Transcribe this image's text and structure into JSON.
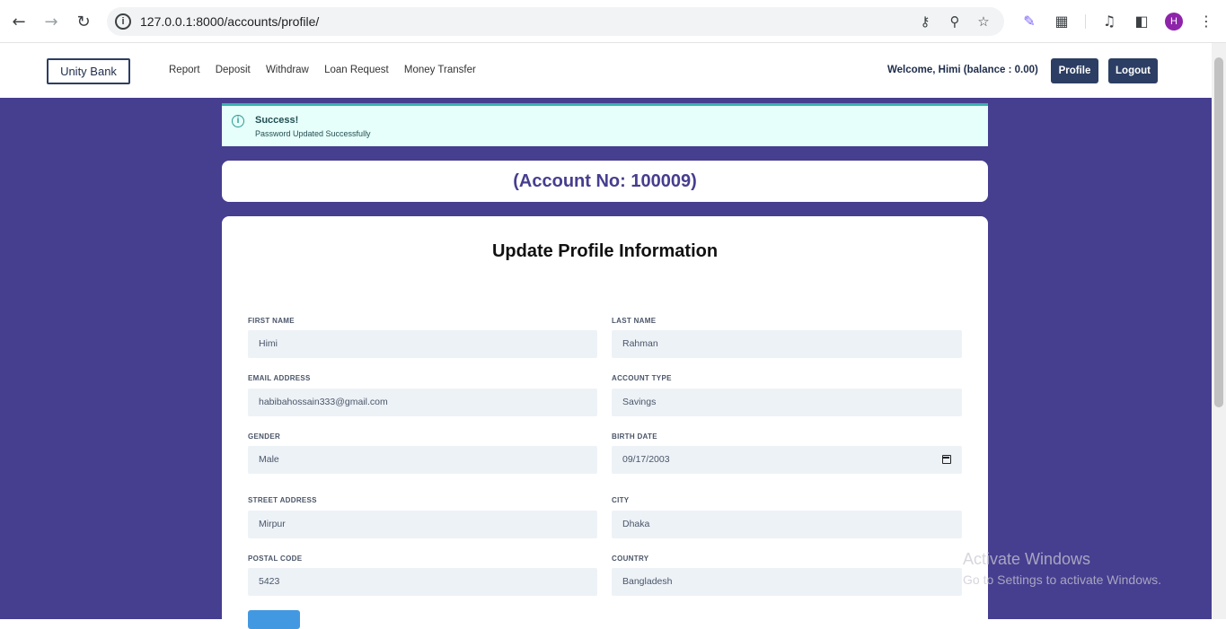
{
  "browser": {
    "url": "127.0.0.1:8000/accounts/profile/",
    "avatar_letter": "H"
  },
  "navbar": {
    "brand": "Unity Bank",
    "links": [
      "Report",
      "Deposit",
      "Withdraw",
      "Loan Request",
      "Money Transfer"
    ],
    "welcome": "Welcome, Himi (balance : 0.00)",
    "profile_label": "Profile",
    "logout_label": "Logout"
  },
  "alert": {
    "title": "Success!",
    "message": "Password Updated Successfully"
  },
  "account": {
    "text": "(Account No: 100009)"
  },
  "form": {
    "title": "Update Profile Information",
    "first_name": {
      "label": "FIRST NAME",
      "value": "Himi"
    },
    "last_name": {
      "label": "LAST NAME",
      "value": "Rahman"
    },
    "email": {
      "label": "EMAIL ADDRESS",
      "value": "habibahossain333@gmail.com"
    },
    "account_type": {
      "label": "ACCOUNT TYPE",
      "value": "Savings"
    },
    "gender": {
      "label": "GENDER",
      "value": "Male"
    },
    "birth_date": {
      "label": "BIRTH DATE",
      "value": "09/17/2003"
    },
    "street": {
      "label": "STREET ADDRESS",
      "value": "Mirpur"
    },
    "city": {
      "label": "CITY",
      "value": "Dhaka"
    },
    "postal": {
      "label": "POSTAL CODE",
      "value": "5423"
    },
    "country": {
      "label": "COUNTRY",
      "value": "Bangladesh"
    }
  },
  "watermark": {
    "line1": "Activate Windows",
    "line2": "Go to Settings to activate Windows."
  },
  "colors": {
    "background": "#463e8f",
    "navy": "#2c3e63",
    "alert_bg": "#e6fffa",
    "alert_border": "#38b2ac"
  }
}
